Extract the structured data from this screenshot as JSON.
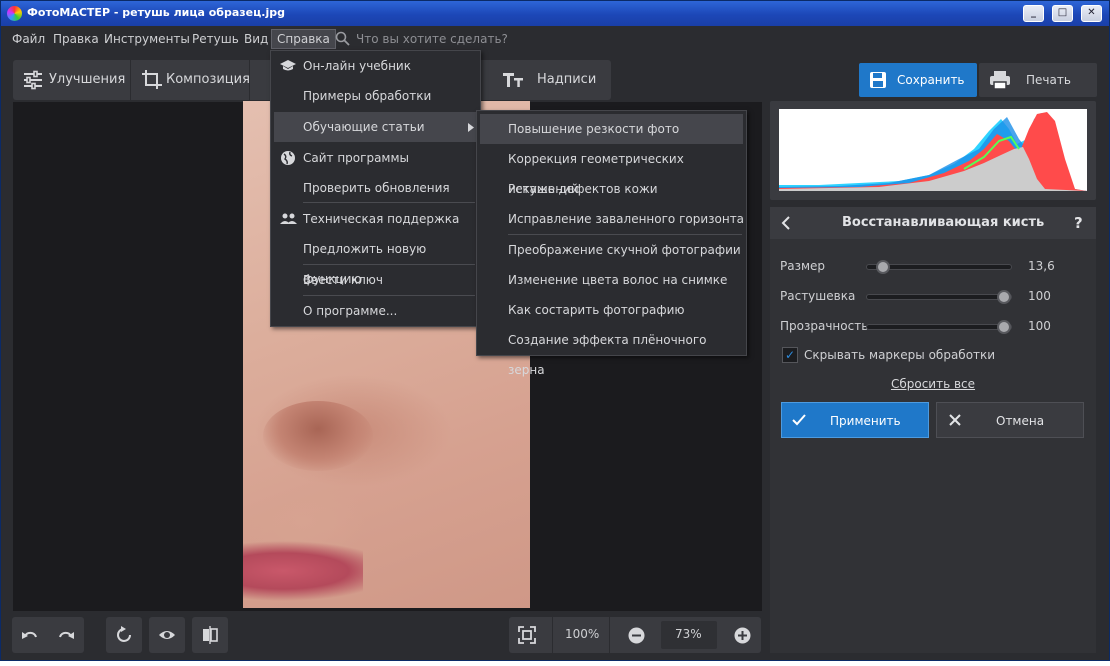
{
  "window": {
    "title": "ФотоМАСТЕР - ретушь лица образец.jpg",
    "min": "_",
    "max": "□",
    "close": "✕"
  },
  "menu": {
    "items": [
      "Файл",
      "Правка",
      "Инструменты",
      "Ретушь",
      "Вид",
      "Справка"
    ],
    "search_placeholder": "Что вы хотите сделать?"
  },
  "tabs": [
    {
      "label": "Улучшения"
    },
    {
      "label": "Композиция"
    },
    {
      "label": "Надписи"
    }
  ],
  "toolbar": {
    "save": "Сохранить",
    "print": "Печать"
  },
  "help_menu": [
    {
      "label": "Он-лайн учебник",
      "icon": "graduation-cap-icon"
    },
    {
      "label": "Примеры обработки"
    },
    {
      "label": "Обучающие статьи",
      "has_submenu": true
    },
    {
      "label": "Сайт программы",
      "icon": "globe-icon"
    },
    {
      "label": "Проверить обновления"
    },
    {
      "label": "Техническая поддержка",
      "icon": "people-icon"
    },
    {
      "label": "Предложить новую функцию"
    },
    {
      "label": "Ввести ключ"
    },
    {
      "label": "О программе..."
    }
  ],
  "articles_submenu": [
    "Повышение резкости фото",
    "Коррекция геометрических искажений",
    "Ретушь дефектов кожи",
    "Исправление заваленного горизонта",
    "Преображение скучной фотографии",
    "Изменение цвета волос на снимке",
    "Как состарить фотографию",
    "Создание эффекта плёночного зерна"
  ],
  "panel": {
    "title": "Восстанавливающая кисть",
    "help": "?",
    "size_label": "Размер",
    "size_value": "13,6",
    "size_fraction": 0.07,
    "feather_label": "Растушевка",
    "feather_value": "100",
    "feather_fraction": 1.0,
    "opacity_label": "Прозрачность",
    "opacity_value": "100",
    "opacity_fraction": 1.0,
    "hide_markers_label": "Скрывать маркеры обработки",
    "hide_markers_checked": true,
    "reset": "Сбросить все",
    "apply": "Применить",
    "cancel": "Отмена"
  },
  "zoom": {
    "fit_value": "100%",
    "current": "73%"
  },
  "colors": {
    "accent": "#1f78c9",
    "bg": "#2b2c30",
    "panel": "#3a3b40"
  }
}
